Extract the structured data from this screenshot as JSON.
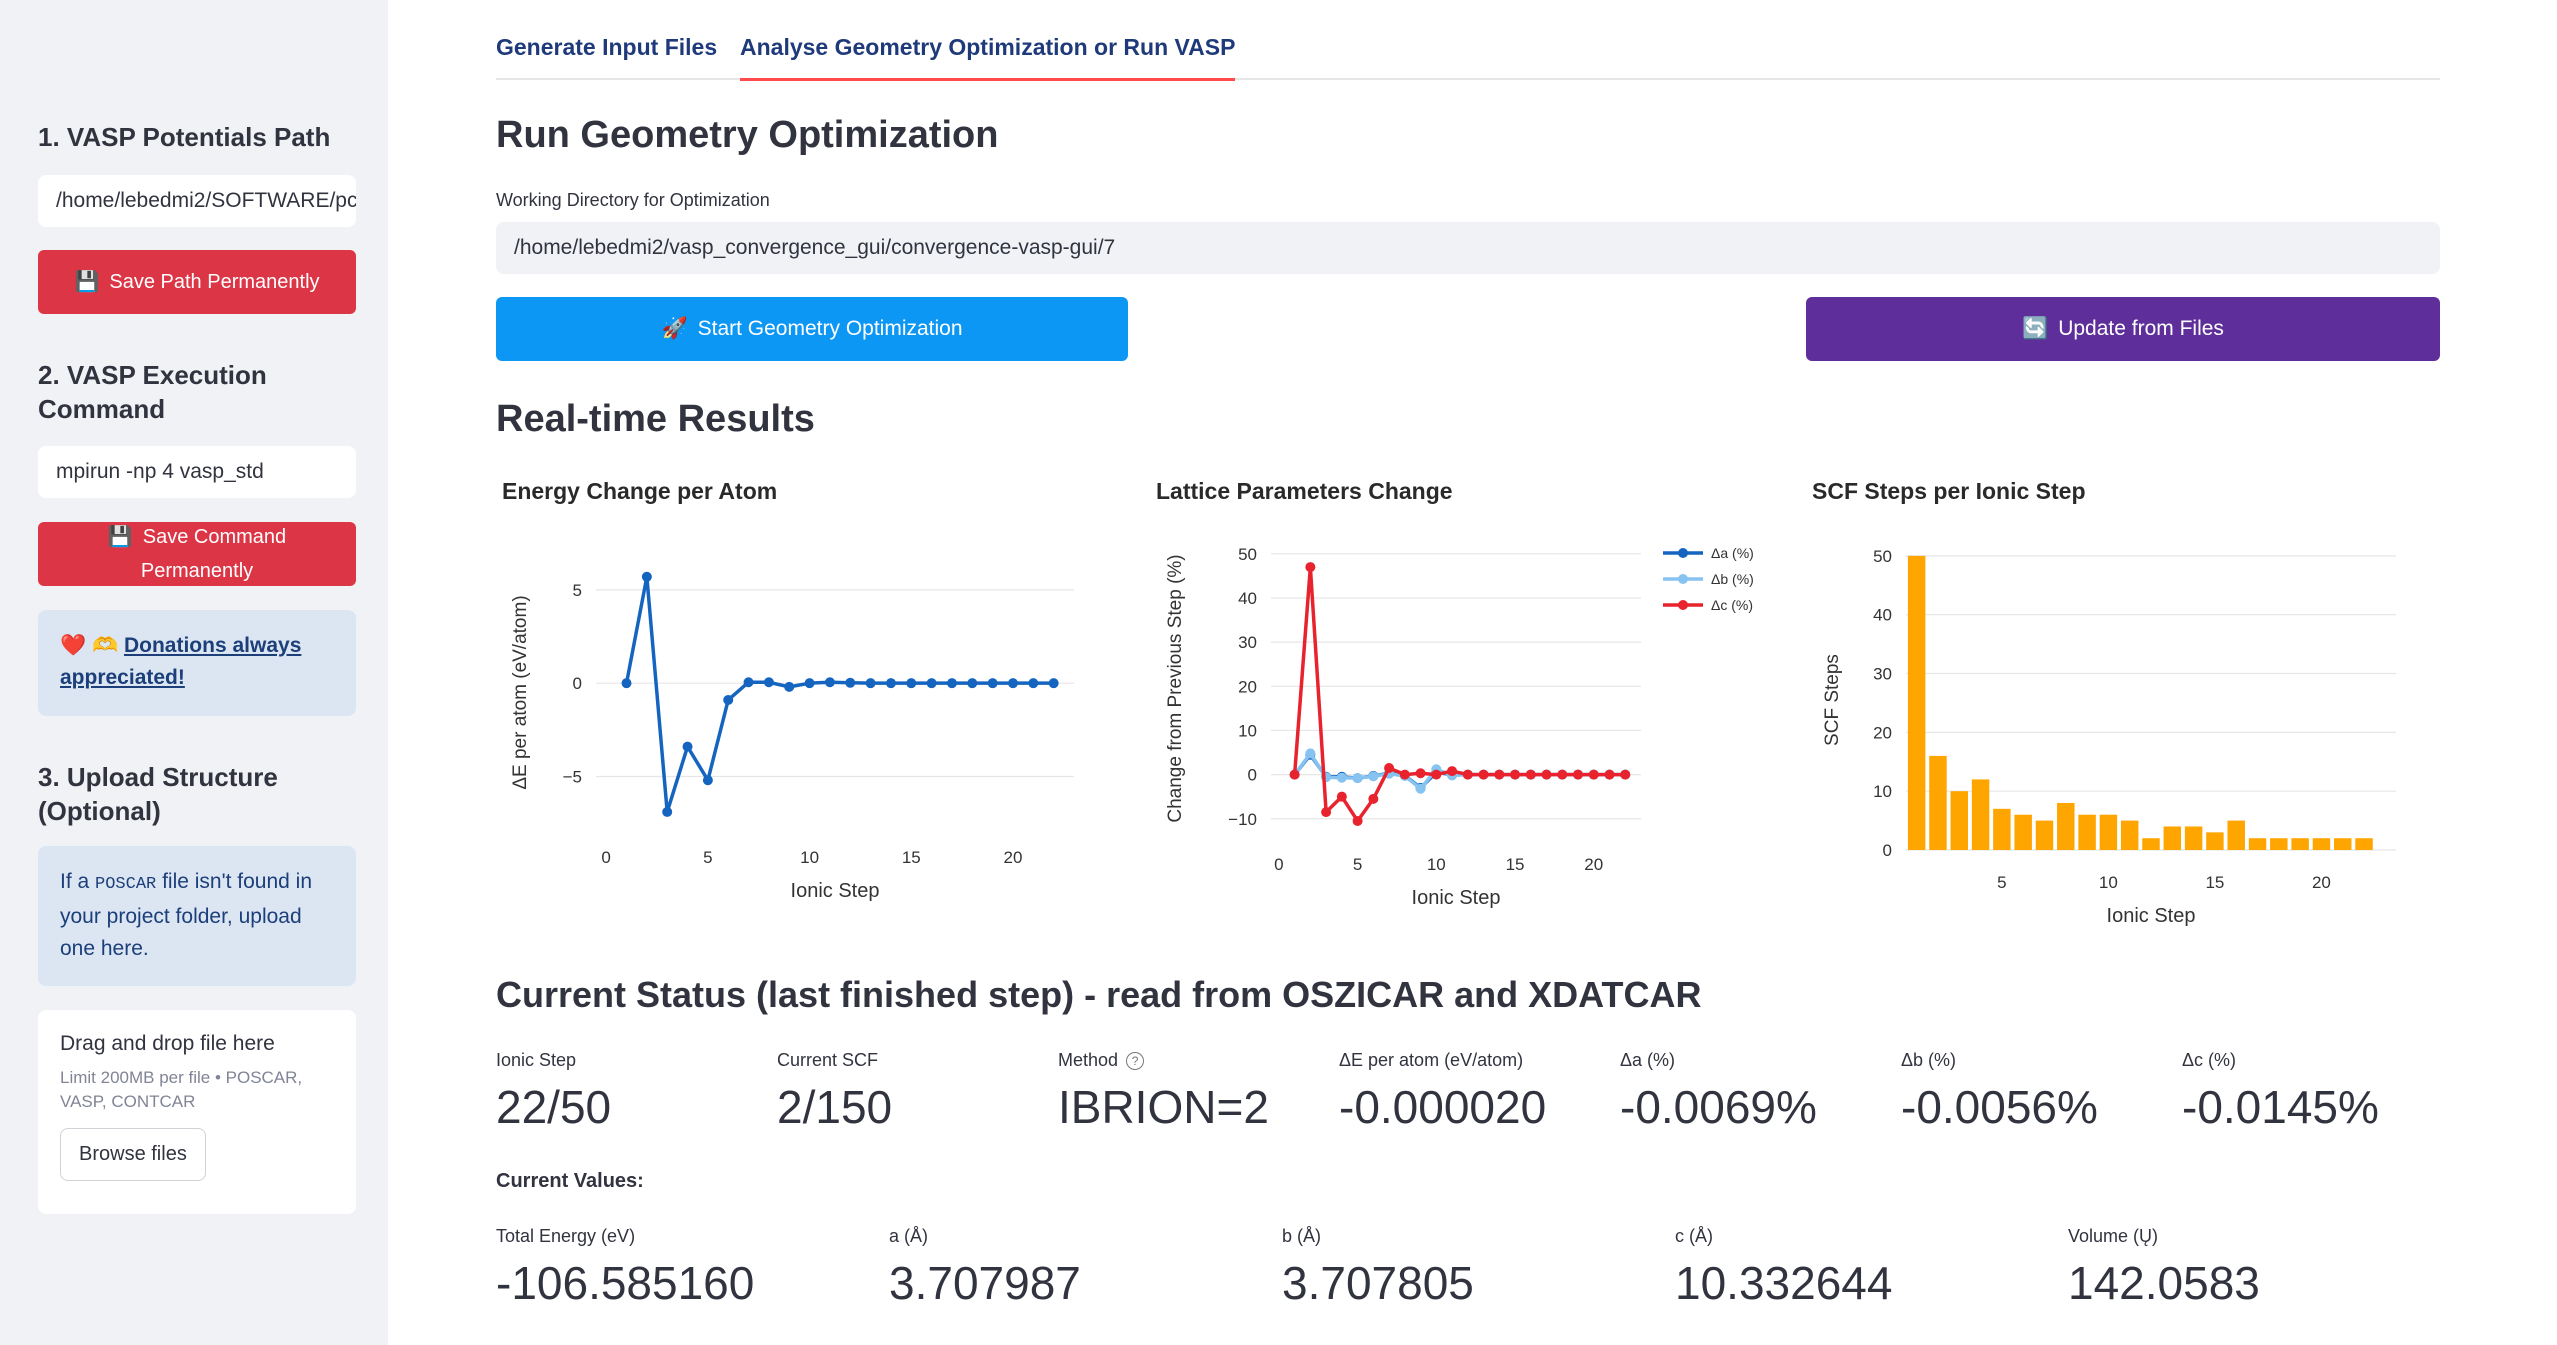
{
  "sidebar": {
    "section1_title": "1. VASP Potentials Path",
    "potentials_path_value": "/home/lebedmi2/SOFTWARE/pc",
    "save_path_label": "Save Path Permanently",
    "section2_title": "2. VASP Execution Command",
    "command_value": "mpirun -np 4 vasp_std",
    "save_command_label": "Save Command Permanently",
    "donation_emoji": "❤️ 🫶",
    "donation_link": "Donations always appreciated!",
    "section3_title": "3. Upload Structure (Optional)",
    "upload_info_prefix": "If a ",
    "upload_info_code": "POSCAR",
    "upload_info_suffix": " file isn't found in your project folder, upload one here.",
    "dropzone_title": "Drag and drop file here",
    "dropzone_hint": "Limit 200MB per file • POSCAR, VASP, CONTCAR",
    "browse_label": "Browse files"
  },
  "tabs": [
    {
      "label": "Generate Input Files",
      "active": false
    },
    {
      "label": "Analyse Geometry Optimization or Run VASP",
      "active": true
    }
  ],
  "main": {
    "title": "Run Geometry Optimization",
    "workdir_label": "Working Directory for Optimization",
    "workdir_value": "/home/lebedmi2/vasp_convergence_gui/convergence-vasp-gui/7",
    "start_button": "Start Geometry Optimization",
    "update_button": "Update from Files",
    "realtime_title": "Real-time Results",
    "status_title": "Current Status (last finished step) - read from OSZICAR and XDATCAR",
    "current_values_label": "Current Values:"
  },
  "colors": {
    "red": "#dc3545",
    "blue_button": "#0d97f5",
    "purple_button": "#5e2f9a",
    "energy_line": "#1565c0",
    "lattice_a": "#1565c0",
    "lattice_b": "#87c3f0",
    "lattice_c": "#e8232e",
    "scf_bar": "#ffa500"
  },
  "chart_data": [
    {
      "type": "line",
      "title": "Energy Change per Atom",
      "xlabel": "Ionic Step",
      "ylabel": "ΔE per atom (eV/atom)",
      "xticks": [
        0,
        5,
        10,
        15,
        20
      ],
      "yticks": [
        -5,
        0,
        5
      ],
      "xlim": [
        -0.5,
        23
      ],
      "ylim": [
        -7.6,
        6.6
      ],
      "series": [
        {
          "color": "#1565c0",
          "x": [
            1,
            2,
            3,
            4,
            5,
            6,
            7,
            8,
            9,
            10,
            11,
            12,
            13,
            14,
            15,
            16,
            17,
            18,
            19,
            20,
            21,
            22
          ],
          "y": [
            0,
            5.7,
            -6.9,
            -3.4,
            -5.2,
            -0.9,
            0.05,
            0.05,
            -0.2,
            0,
            0.05,
            0.02,
            0,
            0,
            0,
            0,
            0,
            0,
            0,
            0,
            0,
            0
          ]
        }
      ]
    },
    {
      "type": "line",
      "title": "Lattice Parameters Change",
      "xlabel": "Ionic Step",
      "ylabel": "Change from Previous Step (%)",
      "xticks": [
        0,
        5,
        10,
        15,
        20
      ],
      "yticks": [
        -10,
        0,
        10,
        20,
        30,
        40,
        50
      ],
      "xlim": [
        -0.5,
        23
      ],
      "ylim": [
        -13,
        52
      ],
      "legend_position": "right",
      "series": [
        {
          "name": "Δa (%)",
          "color": "#1565c0",
          "x": [
            1,
            2,
            3,
            4,
            5,
            6,
            7,
            8,
            9,
            10,
            11,
            12,
            13,
            14,
            15,
            16,
            17,
            18,
            19,
            20,
            21,
            22
          ],
          "y": [
            0,
            4.5,
            -0.5,
            -0.5,
            -0.8,
            -0.3,
            0.3,
            -0.2,
            -3,
            0.5,
            0,
            0,
            0,
            0,
            0,
            0,
            0,
            0,
            0,
            0,
            0,
            0
          ]
        },
        {
          "name": "Δb (%)",
          "color": "#87c3f0",
          "x": [
            1,
            2,
            3,
            4,
            5,
            6,
            7,
            8,
            9,
            10,
            11,
            12,
            13,
            14,
            15,
            16,
            17,
            18,
            19,
            20,
            21,
            22
          ],
          "y": [
            0,
            4.8,
            -0.6,
            -0.7,
            -0.8,
            -0.4,
            0.2,
            -0.3,
            -3.2,
            1.2,
            -0.2,
            0,
            0,
            0,
            0,
            0,
            0,
            0,
            0,
            0,
            0,
            0
          ]
        },
        {
          "name": "Δc (%)",
          "color": "#e8232e",
          "x": [
            1,
            2,
            3,
            4,
            5,
            6,
            7,
            8,
            9,
            10,
            11,
            12,
            13,
            14,
            15,
            16,
            17,
            18,
            19,
            20,
            21,
            22
          ],
          "y": [
            0,
            47,
            -8.5,
            -5,
            -10.5,
            -5.5,
            1.5,
            0,
            0.3,
            0,
            0.8,
            0,
            0,
            0,
            0,
            0,
            0,
            0,
            0,
            0,
            0,
            0
          ]
        }
      ]
    },
    {
      "type": "bar",
      "title": "SCF Steps per Ionic Step",
      "xlabel": "Ionic Step",
      "ylabel": "SCF Steps",
      "xticks": [
        5,
        10,
        15,
        20
      ],
      "yticks": [
        0,
        10,
        20,
        30,
        40,
        50
      ],
      "xlim": [
        0.5,
        23.5
      ],
      "ylim": [
        0,
        51
      ],
      "x": [
        1,
        2,
        3,
        4,
        5,
        6,
        7,
        8,
        9,
        10,
        11,
        12,
        13,
        14,
        15,
        16,
        17,
        18,
        19,
        20,
        21,
        22
      ],
      "values": [
        50,
        16,
        10,
        12,
        7,
        6,
        5,
        8,
        6,
        6,
        5,
        2,
        4,
        4,
        3,
        5,
        2,
        2,
        2,
        2,
        2,
        2
      ],
      "color": "#ffa500"
    }
  ],
  "status_metrics": [
    {
      "label": "Ionic Step",
      "value": "22/50"
    },
    {
      "label": "Current SCF",
      "value": "2/150"
    },
    {
      "label": "Method",
      "value": "IBRION=2",
      "help_icon": "question-circle-icon"
    },
    {
      "label": "ΔE per atom (eV/atom)",
      "value": "-0.000020"
    },
    {
      "label": "Δa (%)",
      "value": "-0.0069%"
    },
    {
      "label": "Δb (%)",
      "value": "-0.0056%"
    },
    {
      "label": "Δc (%)",
      "value": "-0.0145%"
    }
  ],
  "current_values": [
    {
      "label": "Total Energy (eV)",
      "value": "-106.585160"
    },
    {
      "label": "a (Å)",
      "value": "3.707987"
    },
    {
      "label": "b (Å)",
      "value": "3.707805"
    },
    {
      "label": "c (Å)",
      "value": "10.332644"
    },
    {
      "label": "Volume (Ų)",
      "value": "142.0583"
    }
  ]
}
